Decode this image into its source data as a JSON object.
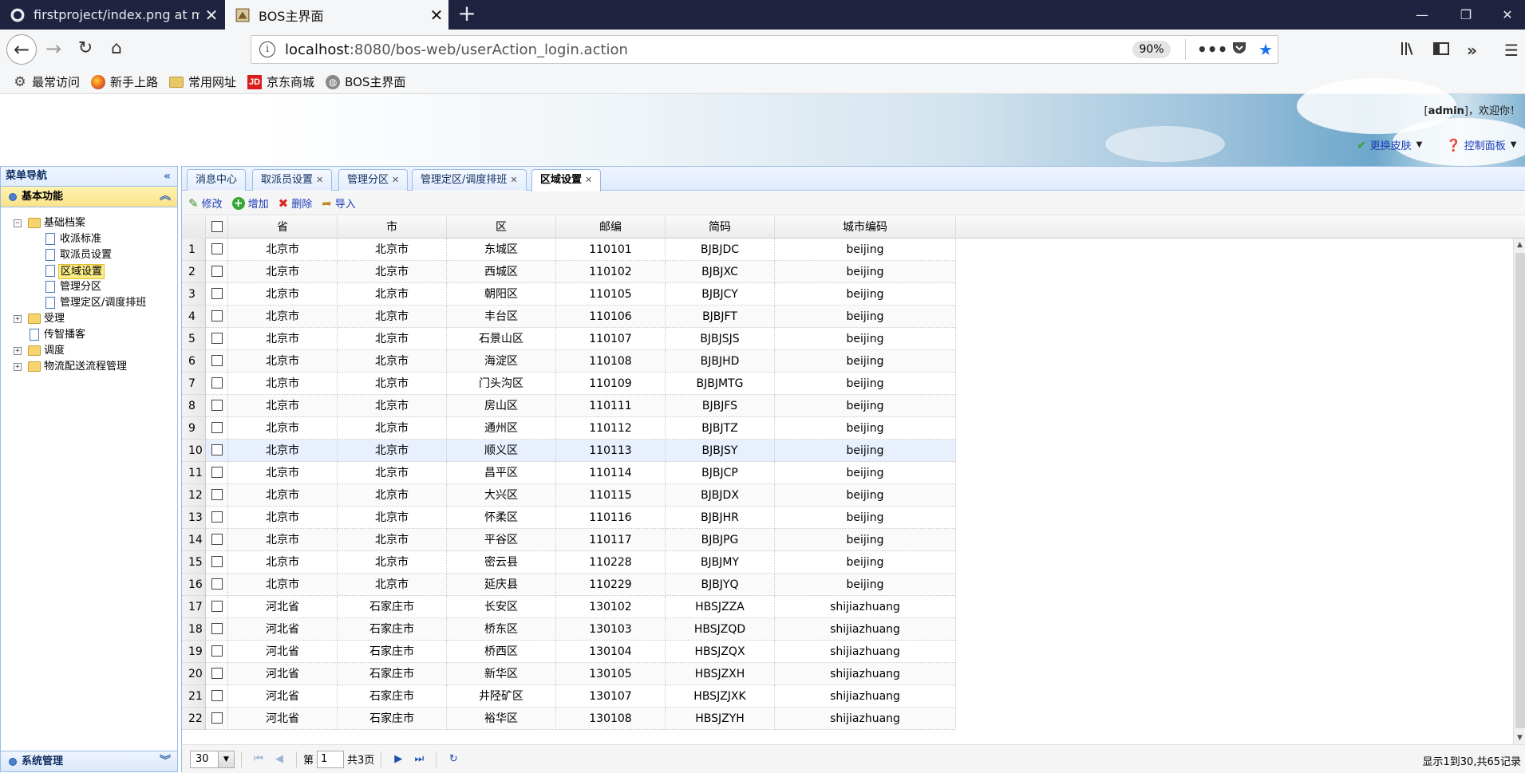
{
  "browser": {
    "tabs": [
      {
        "title": "firstproject/index.png at mas",
        "active": false,
        "icon": "github-icon"
      },
      {
        "title": "BOS主界面",
        "active": true,
        "icon": "bos-icon"
      }
    ],
    "new_tab": "+",
    "url_host": "localhost",
    "url_rest": ":8080/bos-web/userAction_login.action",
    "zoom": "90%",
    "bookmarks": [
      "最常访问",
      "新手上路",
      "常用网址",
      "京东商城",
      "BOS主界面"
    ],
    "jd_glyph": "JD"
  },
  "banner": {
    "user": "admin",
    "welcome_suffix": "，欢迎你！",
    "skin": "更换皮肤",
    "control_panel": "控制面板"
  },
  "west": {
    "title": "菜单导航",
    "section_basic": "基本功能",
    "section_system": "系统管理",
    "tree": {
      "root": "基础档案",
      "children": [
        "收派标准",
        "取派员设置",
        "区域设置",
        "管理分区",
        "管理定区/调度排班"
      ],
      "others": [
        "受理",
        "传智播客",
        "调度",
        "物流配送流程管理"
      ]
    }
  },
  "tabs": [
    "消息中心",
    "取派员设置",
    "管理分区",
    "管理定区/调度排班",
    "区域设置"
  ],
  "active_tab": "区域设置",
  "toolbar": {
    "edit": "修改",
    "add": "增加",
    "delete": "删除",
    "import": "导入"
  },
  "grid": {
    "columns": [
      "省",
      "市",
      "区",
      "邮编",
      "简码",
      "城市编码"
    ],
    "rows": [
      [
        "1",
        "北京市",
        "北京市",
        "东城区",
        "110101",
        "BJBJDC",
        "beijing"
      ],
      [
        "2",
        "北京市",
        "北京市",
        "西城区",
        "110102",
        "BJBJXC",
        "beijing"
      ],
      [
        "3",
        "北京市",
        "北京市",
        "朝阳区",
        "110105",
        "BJBJCY",
        "beijing"
      ],
      [
        "4",
        "北京市",
        "北京市",
        "丰台区",
        "110106",
        "BJBJFT",
        "beijing"
      ],
      [
        "5",
        "北京市",
        "北京市",
        "石景山区",
        "110107",
        "BJBJSJS",
        "beijing"
      ],
      [
        "6",
        "北京市",
        "北京市",
        "海淀区",
        "110108",
        "BJBJHD",
        "beijing"
      ],
      [
        "7",
        "北京市",
        "北京市",
        "门头沟区",
        "110109",
        "BJBJMTG",
        "beijing"
      ],
      [
        "8",
        "北京市",
        "北京市",
        "房山区",
        "110111",
        "BJBJFS",
        "beijing"
      ],
      [
        "9",
        "北京市",
        "北京市",
        "通州区",
        "110112",
        "BJBJTZ",
        "beijing"
      ],
      [
        "10",
        "北京市",
        "北京市",
        "顺义区",
        "110113",
        "BJBJSY",
        "beijing"
      ],
      [
        "11",
        "北京市",
        "北京市",
        "昌平区",
        "110114",
        "BJBJCP",
        "beijing"
      ],
      [
        "12",
        "北京市",
        "北京市",
        "大兴区",
        "110115",
        "BJBJDX",
        "beijing"
      ],
      [
        "13",
        "北京市",
        "北京市",
        "怀柔区",
        "110116",
        "BJBJHR",
        "beijing"
      ],
      [
        "14",
        "北京市",
        "北京市",
        "平谷区",
        "110117",
        "BJBJPG",
        "beijing"
      ],
      [
        "15",
        "北京市",
        "北京市",
        "密云县",
        "110228",
        "BJBJMY",
        "beijing"
      ],
      [
        "16",
        "北京市",
        "北京市",
        "延庆县",
        "110229",
        "BJBJYQ",
        "beijing"
      ],
      [
        "17",
        "河北省",
        "石家庄市",
        "长安区",
        "130102",
        "HBSJZZA",
        "shijiazhuang"
      ],
      [
        "18",
        "河北省",
        "石家庄市",
        "桥东区",
        "130103",
        "HBSJZQD",
        "shijiazhuang"
      ],
      [
        "19",
        "河北省",
        "石家庄市",
        "桥西区",
        "130104",
        "HBSJZQX",
        "shijiazhuang"
      ],
      [
        "20",
        "河北省",
        "石家庄市",
        "新华区",
        "130105",
        "HBSJZXH",
        "shijiazhuang"
      ],
      [
        "21",
        "河北省",
        "石家庄市",
        "井陉矿区",
        "130107",
        "HBSJZJXK",
        "shijiazhuang"
      ],
      [
        "22",
        "河北省",
        "石家庄市",
        "裕华区",
        "130108",
        "HBSJZYH",
        "shijiazhuang"
      ]
    ],
    "highlighted_row": 10
  },
  "pager": {
    "page_size": "30",
    "page_label_before": "第",
    "page_value": "1",
    "page_label_after": "共3页",
    "info": "显示1到30,共65记录"
  },
  "colors": {
    "header_bg": "#202340",
    "panel_border": "#99bbe8",
    "link": "#1a3db8"
  }
}
